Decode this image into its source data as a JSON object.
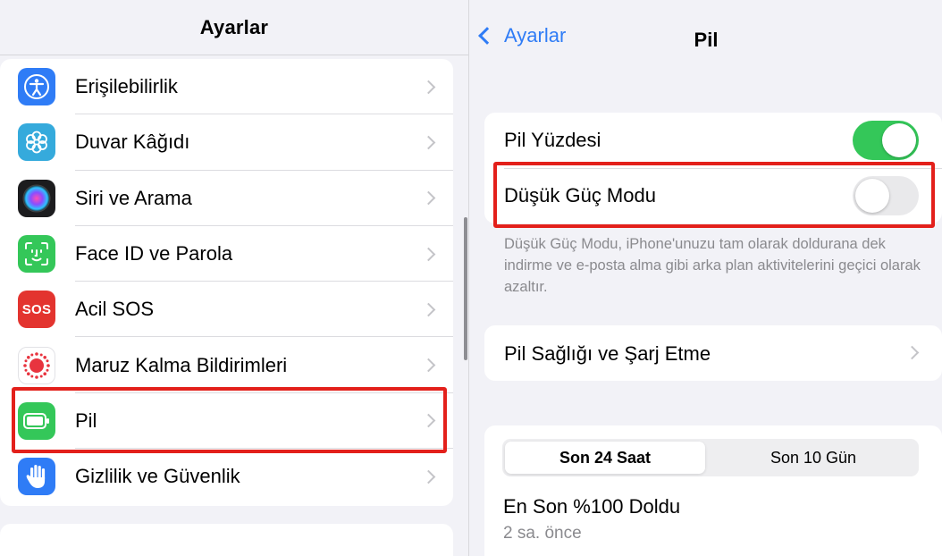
{
  "left": {
    "title": "Ayarlar",
    "items": [
      {
        "label": "Erişilebilirlik",
        "icon": "accessibility-icon",
        "color": "#2f7cf6"
      },
      {
        "label": "Duvar Kâğıdı",
        "icon": "wallpaper-icon",
        "color": "#35aadc"
      },
      {
        "label": "Siri ve Arama",
        "icon": "siri-icon",
        "color": "#1c1c1e"
      },
      {
        "label": "Face ID ve Parola",
        "icon": "face-id-icon",
        "color": "#34c759"
      },
      {
        "label": "Acil SOS",
        "icon": "sos-icon",
        "icon_text": "SOS",
        "color": "#e3342f"
      },
      {
        "label": "Maruz Kalma Bildirimleri",
        "icon": "exposure-notification-icon",
        "color": "#ffffff"
      },
      {
        "label": "Pil",
        "icon": "battery-icon",
        "color": "#34c759",
        "selected": true
      },
      {
        "label": "Gizlilik ve Güvenlik",
        "icon": "hand-icon",
        "color": "#2f7cf6"
      }
    ]
  },
  "right": {
    "back_label": "Ayarlar",
    "title": "Pil",
    "battery_percentage": {
      "label": "Pil Yüzdesi",
      "on": true
    },
    "low_power_mode": {
      "label": "Düşük Güç Modu",
      "on": false
    },
    "footnote": "Düşük Güç Modu, iPhone'unuzu tam olarak doldurana dek indirme ve e-posta alma gibi arka plan aktivitelerini geçici olarak azaltır.",
    "battery_health": {
      "label": "Pil Sağlığı ve Şarj Etme"
    },
    "segments": [
      "Son 24 Saat",
      "Son 10 Gün"
    ],
    "active_segment": "Son 24 Saat",
    "last_charge_title": "En Son %100 Doldu",
    "last_charge_time": "2 sa. önce"
  },
  "colors": {
    "accent": "#2f7cf6",
    "toggle_on": "#34c759",
    "toggle_off": "#e9e9eb",
    "highlight": "#e3201b"
  }
}
